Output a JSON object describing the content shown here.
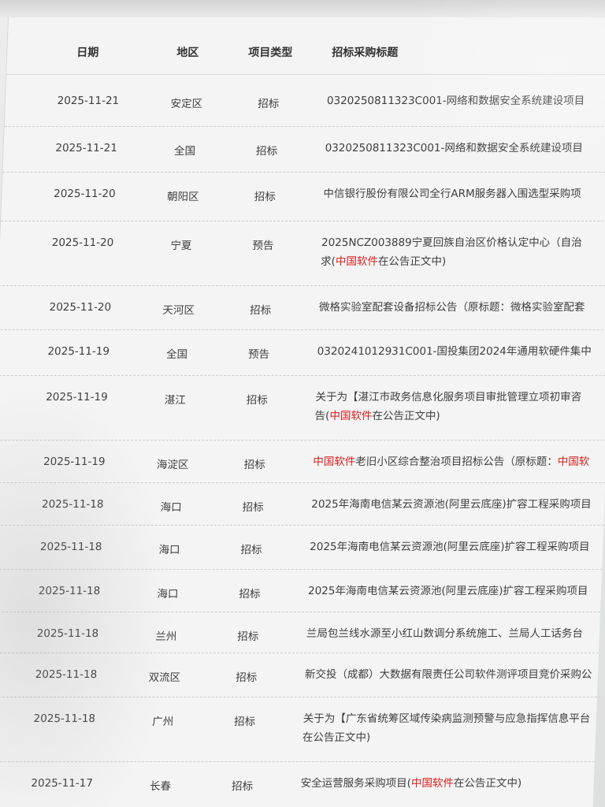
{
  "headers": {
    "date": "日期",
    "region": "地区",
    "type": "项目类型",
    "title": "招标采购标题"
  },
  "rows": [
    {
      "date": "2025-11-21",
      "region": "安定区",
      "type": "招标",
      "lines": [
        [
          "0320250811323C001-网络和数据安全系统建设项目"
        ]
      ]
    },
    {
      "date": "2025-11-21",
      "region": "全国",
      "type": "招标",
      "lines": [
        [
          "0320250811323C001-网络和数据安全系统建设项目"
        ]
      ]
    },
    {
      "date": "2025-11-20",
      "region": "朝阳区",
      "type": "招标",
      "lines": [
        [
          "中信银行股份有限公司全行ARM服务器入围选型采购项"
        ]
      ]
    },
    {
      "date": "2025-11-20",
      "region": "宁夏",
      "type": "预告",
      "lines": [
        [
          "2025NCZ003889宁夏回族自治区价格认定中心（自治"
        ],
        [
          "求(",
          {
            "hl": "中国软件"
          },
          "在公告正文中)"
        ]
      ]
    },
    {
      "date": "2025-11-20",
      "region": "天河区",
      "type": "招标",
      "lines": [
        [
          "微格实验室配套设备招标公告（原标题：微格实验室配套"
        ]
      ]
    },
    {
      "date": "2025-11-19",
      "region": "全国",
      "type": "预告",
      "lines": [
        [
          "0320241012931C001-国投集团2024年通用软硬件集中"
        ]
      ]
    },
    {
      "date": "2025-11-19",
      "region": "湛江",
      "type": "招标",
      "lines": [
        [
          "关于为【湛江市政务信息化服务项目审批管理立项初审咨"
        ],
        [
          "告(",
          {
            "hl": "中国软件"
          },
          "在公告正文中)"
        ]
      ]
    },
    {
      "date": "2025-11-19",
      "region": "海淀区",
      "type": "招标",
      "lines": [
        [
          {
            "hl": "中国软件"
          },
          "老旧小区综合整治项目招标公告（原标题：",
          {
            "hl": "中国软"
          }
        ]
      ]
    },
    {
      "date": "2025-11-18",
      "region": "海口",
      "type": "招标",
      "lines": [
        [
          "2025年海南电信某云资源池(阿里云底座)扩容工程采购项目"
        ]
      ]
    },
    {
      "date": "2025-11-18",
      "region": "海口",
      "type": "招标",
      "lines": [
        [
          "2025年海南电信某云资源池(阿里云底座)扩容工程采购项目"
        ]
      ]
    },
    {
      "date": "2025-11-18",
      "region": "海口",
      "type": "招标",
      "lines": [
        [
          "2025年海南电信某云资源池(阿里云底座)扩容工程采购项目"
        ]
      ]
    },
    {
      "date": "2025-11-18",
      "region": "兰州",
      "type": "招标",
      "lines": [
        [
          "兰局包兰线水源至小红山数调分系统施工、兰局人工话务台"
        ]
      ]
    },
    {
      "date": "2025-11-18",
      "region": "双流区",
      "type": "招标",
      "lines": [
        [
          "新交投（成都）大数据有限责任公司软件测评项目竞价采购公"
        ]
      ]
    },
    {
      "date": "2025-11-18",
      "region": "广州",
      "type": "招标",
      "lines": [
        [
          "关于为【广东省统筹区域传染病监测预警与应急指挥信息平台"
        ],
        [
          "在公告正文中)"
        ]
      ]
    },
    {
      "date": "2025-11-17",
      "region": "长春",
      "type": "招标",
      "lines": [
        [
          "安全运营服务采购项目(",
          {
            "hl": "中国软件"
          },
          "在公告正文中)"
        ]
      ]
    }
  ]
}
